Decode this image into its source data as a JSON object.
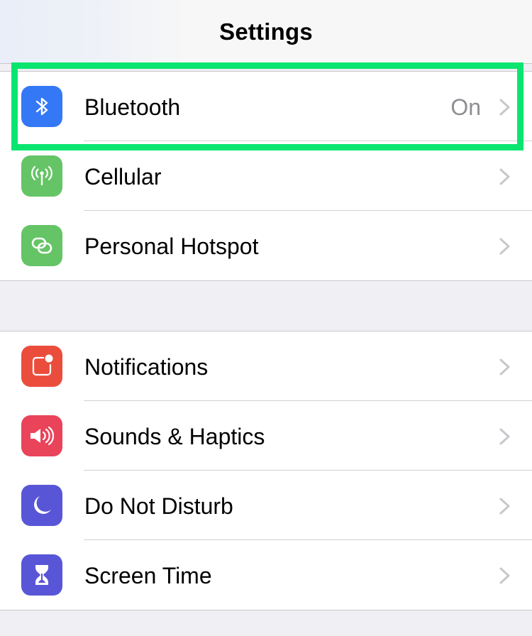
{
  "navbar": {
    "title": "Settings"
  },
  "groups": [
    {
      "rows": [
        {
          "label": "Bluetooth",
          "value": "On",
          "icon": "bluetooth-icon",
          "icon_color": "#3478f6"
        },
        {
          "label": "Cellular",
          "value": "",
          "icon": "cellular-antenna-icon",
          "icon_color": "#65c466"
        },
        {
          "label": "Personal Hotspot",
          "value": "",
          "icon": "hotspot-link-icon",
          "icon_color": "#65c466"
        }
      ]
    },
    {
      "rows": [
        {
          "label": "Notifications",
          "value": "",
          "icon": "notifications-icon",
          "icon_color": "#eb4d3d"
        },
        {
          "label": "Sounds & Haptics",
          "value": "",
          "icon": "speaker-icon",
          "icon_color": "#e9445a"
        },
        {
          "label": "Do Not Disturb",
          "value": "",
          "icon": "moon-icon",
          "icon_color": "#5856d6"
        },
        {
          "label": "Screen Time",
          "value": "",
          "icon": "hourglass-icon",
          "icon_color": "#5856d6"
        }
      ]
    }
  ],
  "highlight": {
    "target": "Bluetooth",
    "color": "#0ae56f"
  },
  "colors": {
    "background": "#efeff4",
    "separator": "#d1d1d6",
    "secondary_text": "#8e8e93",
    "chevron": "#c7c7cc"
  }
}
